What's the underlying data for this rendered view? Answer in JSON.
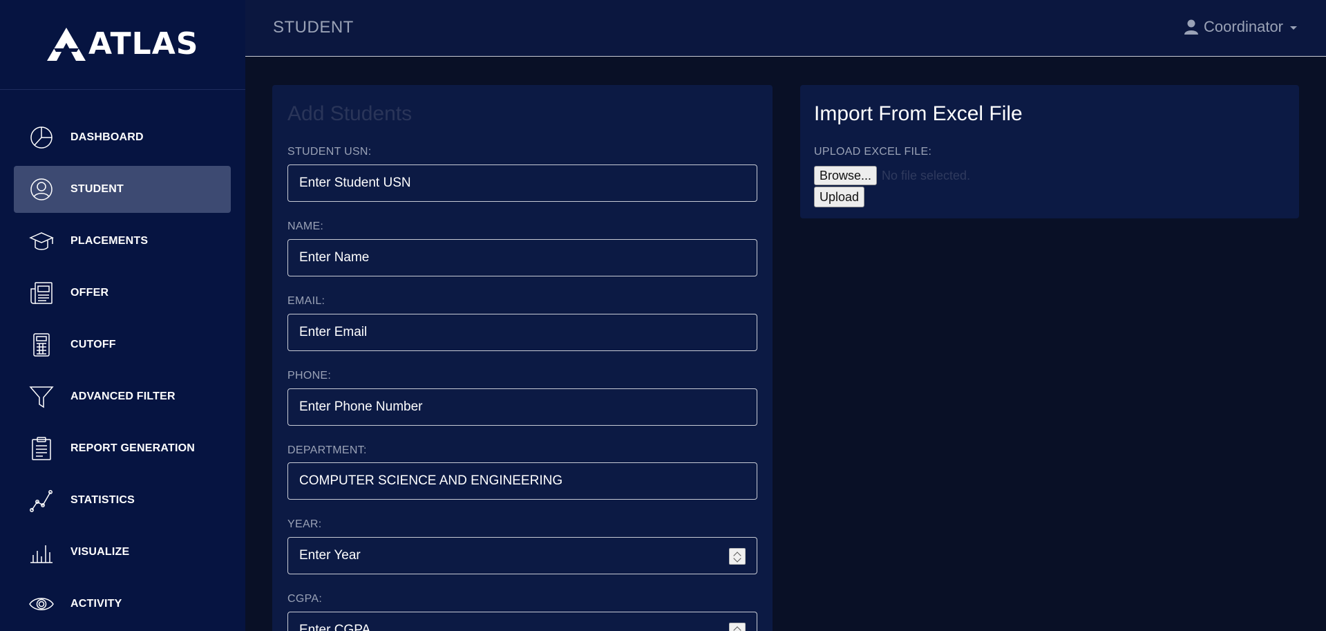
{
  "app": {
    "logo_text": "ATLAS"
  },
  "header": {
    "title": "STUDENT",
    "user_label": "Coordinator"
  },
  "sidebar": {
    "items": [
      {
        "label": "DASHBOARD",
        "icon": "pie-chart-icon"
      },
      {
        "label": "STUDENT",
        "icon": "user-circle-icon",
        "active": true
      },
      {
        "label": "PLACEMENTS",
        "icon": "graduation-cap-icon"
      },
      {
        "label": "OFFER",
        "icon": "newspaper-icon"
      },
      {
        "label": "CUTOFF",
        "icon": "calculator-icon"
      },
      {
        "label": "ADVANCED FILTER",
        "icon": "filter-icon"
      },
      {
        "label": "REPORT GENERATION",
        "icon": "clipboard-icon"
      },
      {
        "label": "STATISTICS",
        "icon": "line-chart-icon"
      },
      {
        "label": "VISUALIZE",
        "icon": "bar-chart-icon"
      },
      {
        "label": "ACTIVITY",
        "icon": "eye-icon"
      }
    ]
  },
  "add_form": {
    "title": "Add Students",
    "fields": [
      {
        "label": "STUDENT USN:",
        "placeholder": "Enter Student USN",
        "value": ""
      },
      {
        "label": "NAME:",
        "placeholder": "Enter Name",
        "value": ""
      },
      {
        "label": "EMAIL:",
        "placeholder": "Enter Email",
        "value": ""
      },
      {
        "label": "PHONE:",
        "placeholder": "Enter Phone Number",
        "value": ""
      },
      {
        "label": "DEPARTMENT:",
        "placeholder": "",
        "value": "COMPUTER SCIENCE AND ENGINEERING"
      },
      {
        "label": "YEAR:",
        "placeholder": "Enter Year",
        "value": ""
      },
      {
        "label": "CGPA:",
        "placeholder": "Enter CGPA",
        "value": ""
      }
    ]
  },
  "import": {
    "title": "Import From Excel File",
    "upload_label": "UPLOAD EXCEL FILE:",
    "browse_label": "Browse...",
    "no_file_text": "No file selected.",
    "upload_button": "Upload"
  },
  "colors": {
    "sidebar_bg": "#061441",
    "active_item_bg": "#3d4a72",
    "page_bg": "#091026",
    "card_bg": "#0c1a44"
  }
}
